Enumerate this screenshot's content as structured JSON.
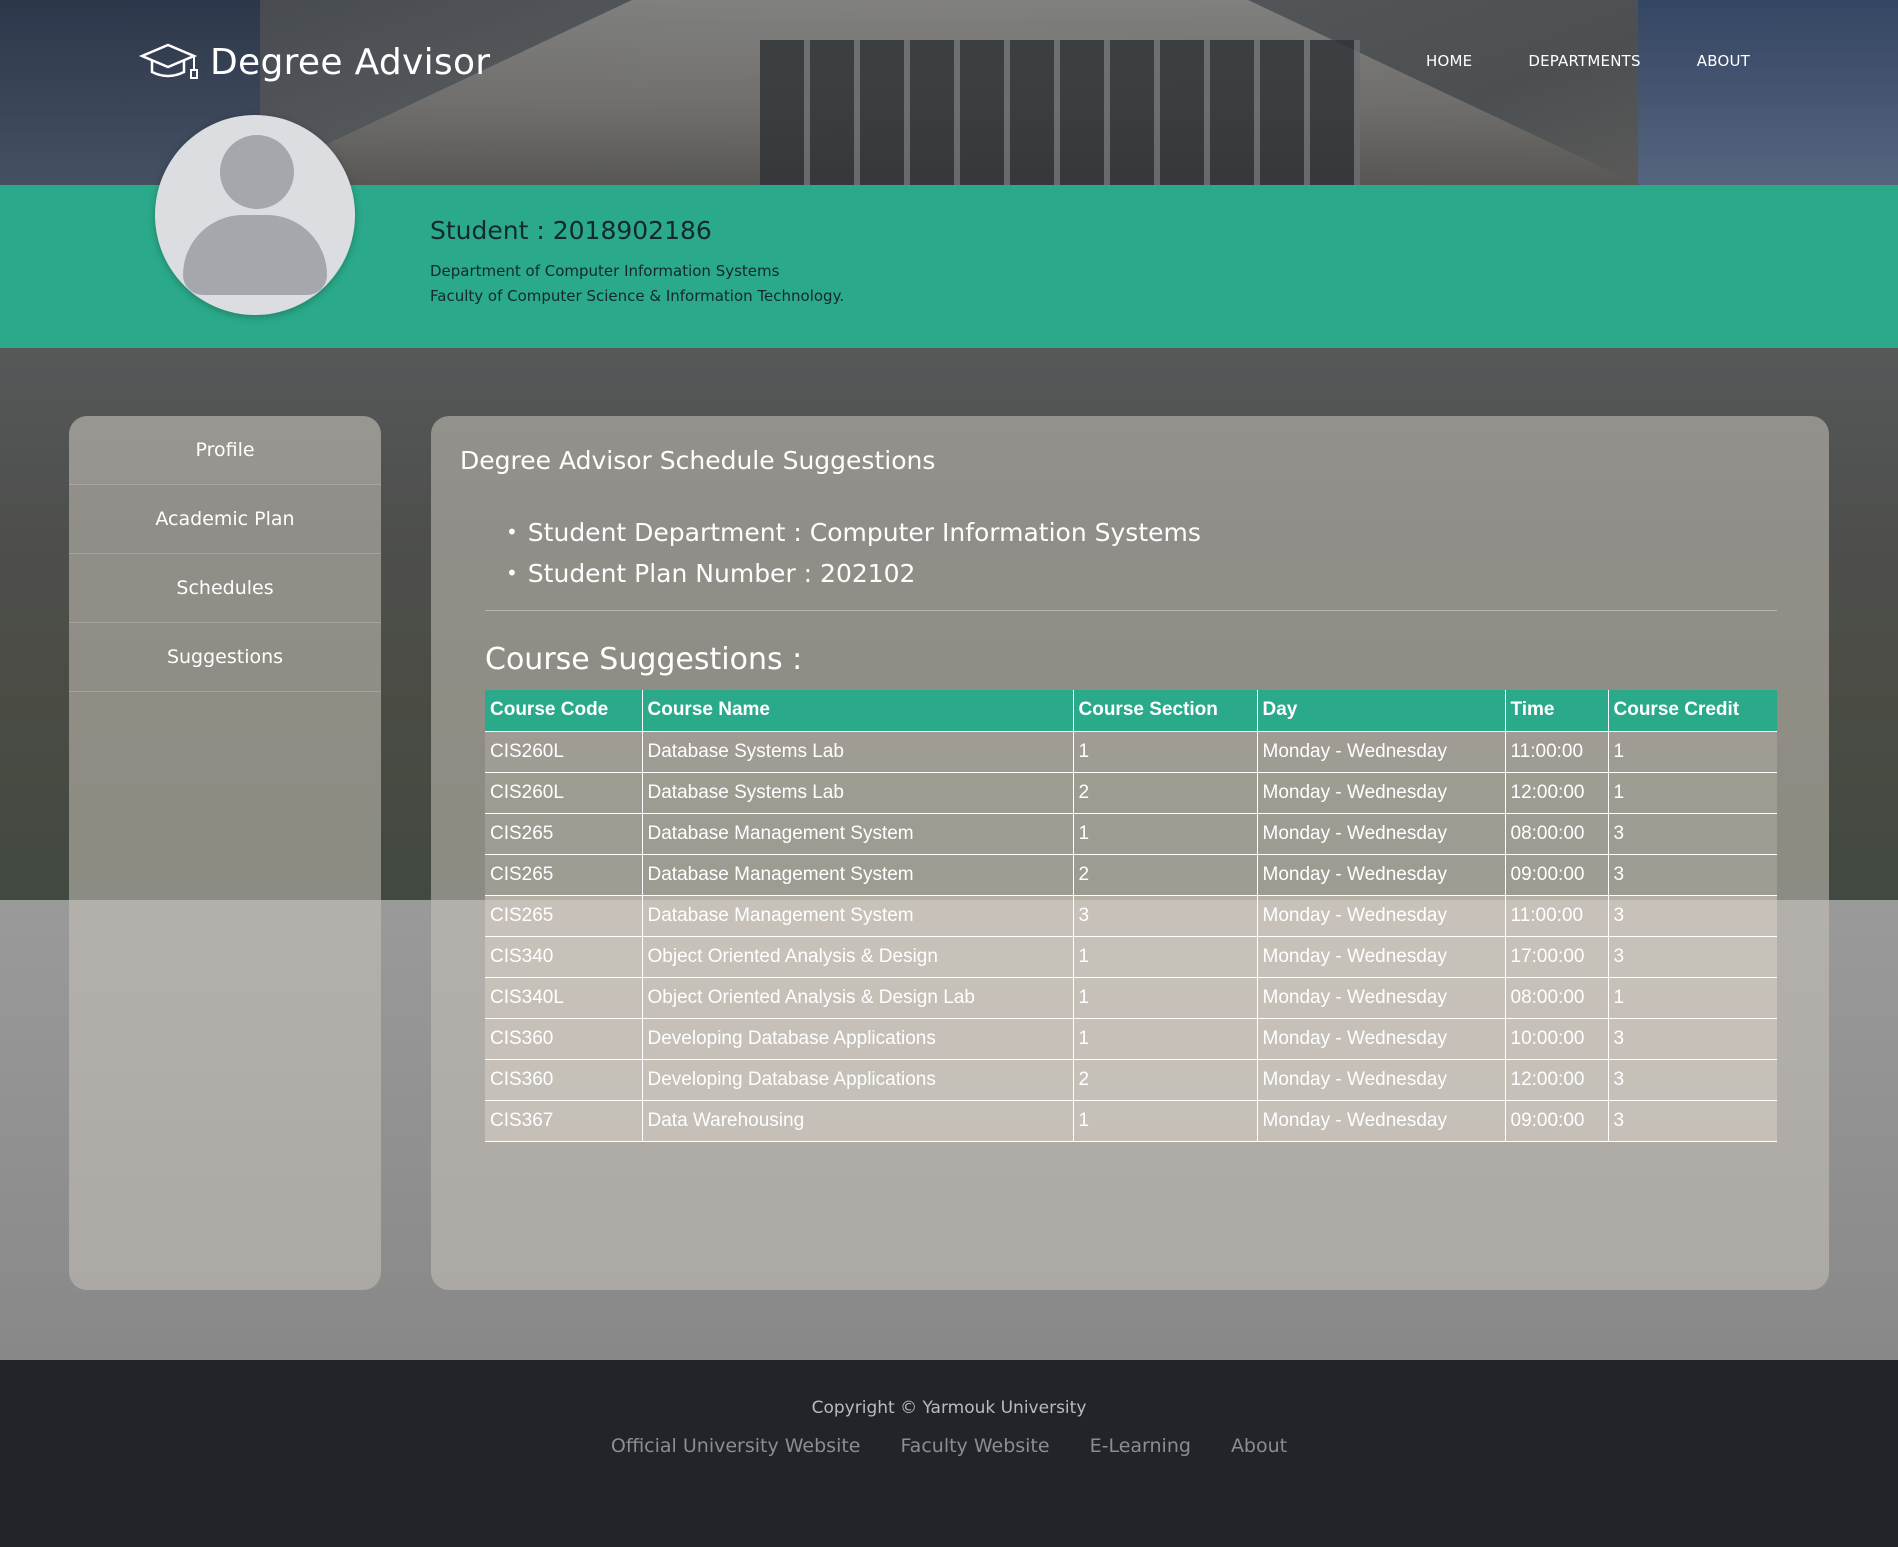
{
  "header": {
    "brand": "Degree Advisor",
    "brand_icon": "graduation-cap-icon",
    "nav": [
      "HOME",
      "DEPARTMENTS",
      "ABOUT"
    ]
  },
  "student": {
    "id_label": "Student : 2018902186",
    "department": "Department of Computer Information Systems",
    "faculty": "Faculty of Computer Science & Information Technology.",
    "avatar_icon": "user-avatar-icon"
  },
  "sidebar": {
    "items": [
      "Profile",
      "Academic Plan",
      "Schedules",
      "Suggestions"
    ]
  },
  "panel": {
    "title": "Degree Advisor Schedule Suggestions",
    "bullets": [
      "Student Department : Computer Information Systems",
      "Student Plan Number : 202102"
    ],
    "section_title": "Course Suggestions :"
  },
  "table": {
    "headers": [
      "Course Code",
      "Course Name",
      "Course Section",
      "Day",
      "Time",
      "Course Credit"
    ],
    "rows": [
      [
        "CIS260L",
        "Database Systems Lab",
        "1",
        "Monday - Wednesday",
        "11:00:00",
        "1"
      ],
      [
        "CIS260L",
        "Database Systems Lab",
        "2",
        "Monday - Wednesday",
        "12:00:00",
        "1"
      ],
      [
        "CIS265",
        "Database Management System",
        "1",
        "Monday - Wednesday",
        "08:00:00",
        "3"
      ],
      [
        "CIS265",
        "Database Management System",
        "2",
        "Monday - Wednesday",
        "09:00:00",
        "3"
      ],
      [
        "CIS265",
        "Database Management System",
        "3",
        "Monday - Wednesday",
        "11:00:00",
        "3"
      ],
      [
        "CIS340",
        "Object Oriented Analysis & Design",
        "1",
        "Monday - Wednesday",
        "17:00:00",
        "3"
      ],
      [
        "CIS340L",
        "Object Oriented Analysis & Design Lab",
        "1",
        "Monday - Wednesday",
        "08:00:00",
        "1"
      ],
      [
        "CIS360",
        "Developing Database Applications",
        "1",
        "Monday - Wednesday",
        "10:00:00",
        "3"
      ],
      [
        "CIS360",
        "Developing Database Applications",
        "2",
        "Monday - Wednesday",
        "12:00:00",
        "3"
      ],
      [
        "CIS367",
        "Data Warehousing",
        "1",
        "Monday - Wednesday",
        "09:00:00",
        "3"
      ]
    ]
  },
  "footer": {
    "copyright": "Copyright © Yarmouk University",
    "links": [
      "Official University Website",
      "Faculty Website",
      "E-Learning",
      "About"
    ]
  },
  "colors": {
    "accent": "#2aaa8a",
    "footer_bg": "#212428"
  }
}
